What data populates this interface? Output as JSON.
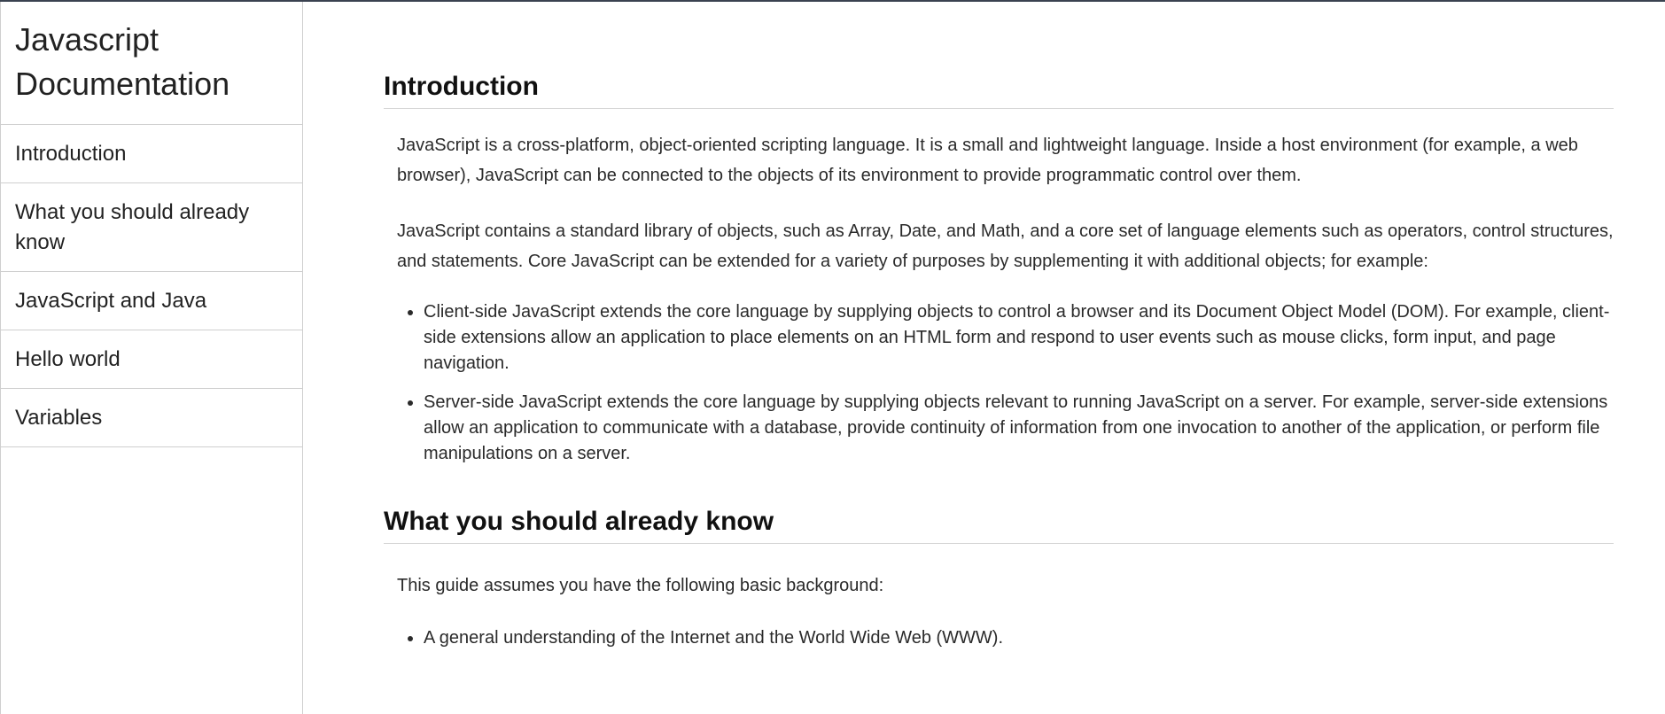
{
  "nav": {
    "title": "Javascript Documentation",
    "links": [
      "Introduction",
      "What you should already know",
      "JavaScript and Java",
      "Hello world",
      "Variables"
    ]
  },
  "sections": {
    "introduction": {
      "title": "Introduction",
      "paragraphs": [
        "JavaScript is a cross-platform, object-oriented scripting language. It is a small and lightweight language. Inside a host environment (for example, a web browser), JavaScript can be connected to the objects of its environment to provide programmatic control over them.",
        "JavaScript contains a standard library of objects, such as Array, Date, and Math, and a core set of language elements such as operators, control structures, and statements. Core JavaScript can be extended for a variety of purposes by supplementing it with additional objects; for example:"
      ],
      "list": [
        "Client-side JavaScript extends the core language by supplying objects to control a browser and its Document Object Model (DOM). For example, client-side extensions allow an application to place elements on an HTML form and respond to user events such as mouse clicks, form input, and page navigation.",
        "Server-side JavaScript extends the core language by supplying objects relevant to running JavaScript on a server. For example, server-side extensions allow an application to communicate with a database, provide continuity of information from one invocation to another of the application, or perform file manipulations on a server."
      ]
    },
    "what_you_should_know": {
      "title": "What you should already know",
      "paragraphs": [
        "This guide assumes you have the following basic background:"
      ],
      "list": [
        "A general understanding of the Internet and the World Wide Web (WWW)."
      ]
    }
  }
}
